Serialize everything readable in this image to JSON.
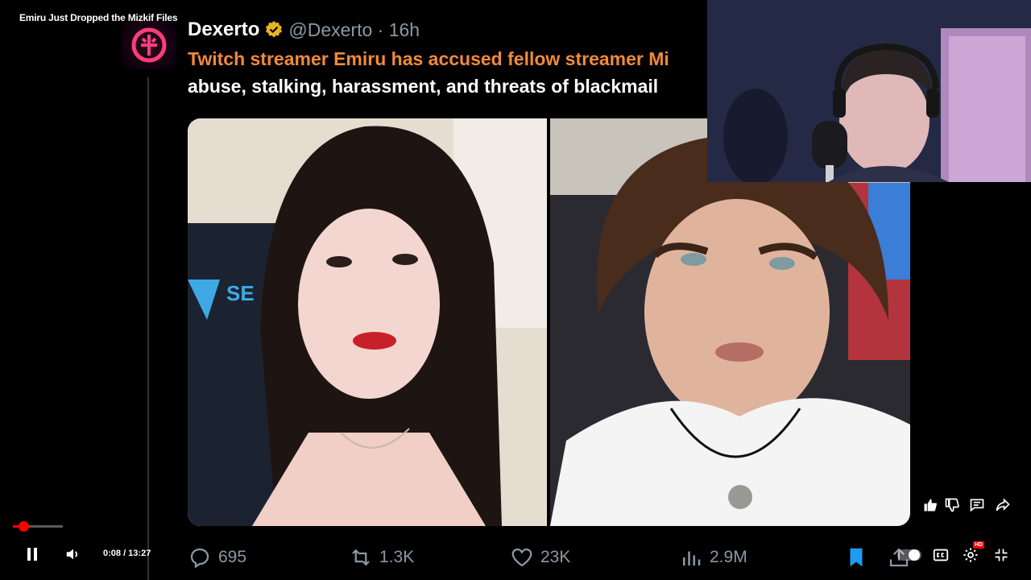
{
  "video": {
    "title": "Emiru Just Dropped the Mizkif Files"
  },
  "tweet": {
    "display_name": "Dexerto",
    "handle_time": "@Dexerto · 16h",
    "text_line_1": "Twitch streamer Emiru has accused fellow streamer Mi",
    "text_line_2": "abuse, stalking, harassment, and threats of blackmail",
    "highlight_color": "#f08a3c",
    "media_logo_text": "SE",
    "actions": {
      "replies": "695",
      "retweets": "1.3K",
      "likes": "23K",
      "views": "2.9M"
    }
  },
  "player": {
    "time": "0:08 / 13:27",
    "progress_fraction": 0.01,
    "quality_badge": "HD",
    "state": "playing",
    "accent_color": "#ff0000"
  },
  "icons": {
    "play_pause": "pause-icon",
    "volume": "volume-icon",
    "captions": "captions-icon",
    "settings": "settings-icon",
    "fullscreen": "exit-fullscreen-icon",
    "like": "thumbs-up-icon",
    "dislike": "thumbs-down-icon",
    "comments": "comment-icon",
    "share": "share-icon"
  }
}
